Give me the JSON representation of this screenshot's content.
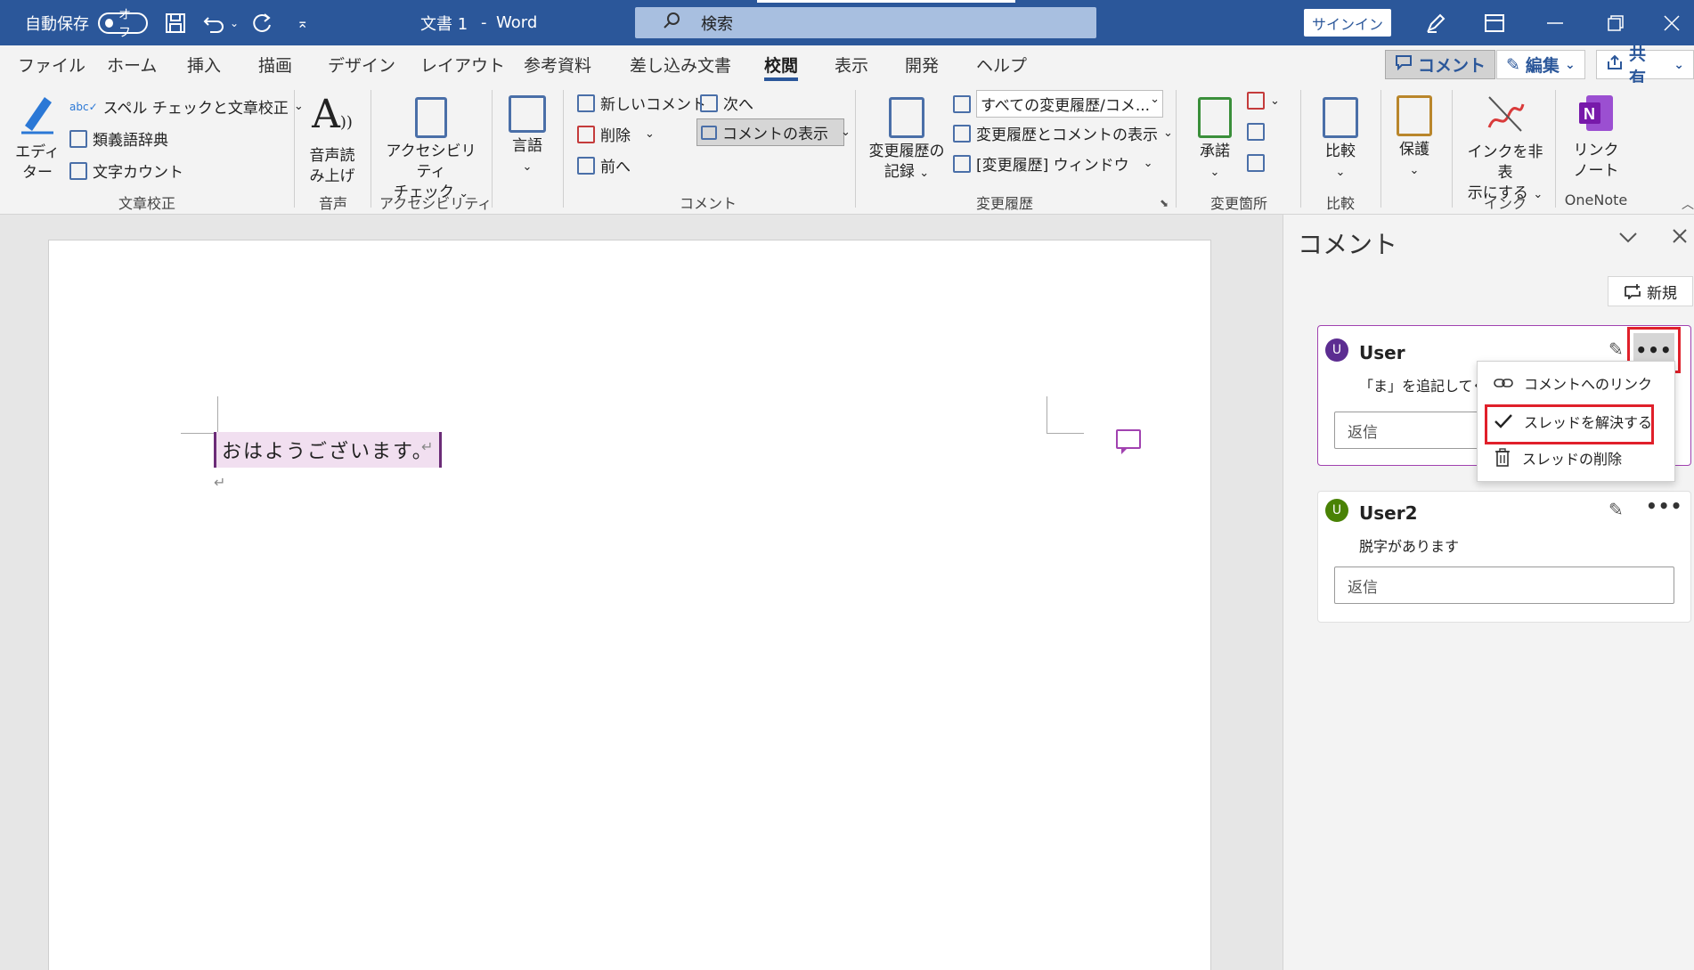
{
  "titlebar": {
    "autosave_label": "自動保存",
    "autosave_state": "オフ",
    "doc_title": "文書 1",
    "title_sep": "-",
    "app_name": "Word",
    "search_placeholder": "検索",
    "signin_label": "サインイン",
    "icons": [
      "save-icon",
      "undo-icon",
      "redo-icon",
      "customize-icon",
      "pen-icon",
      "ribbon-display-icon",
      "minimize-icon",
      "restore-icon",
      "close-icon"
    ]
  },
  "menu_tabs": [
    "ファイル",
    "ホーム",
    "挿入",
    "描画",
    "デザイン",
    "レイアウト",
    "参考資料",
    "差し込み文書",
    "校閲",
    "表示",
    "開発",
    "ヘルプ"
  ],
  "active_tab": "校閲",
  "menu_right": {
    "comment_label": "コメント",
    "edit_label": "編集",
    "share_label": "共有"
  },
  "ribbon": {
    "proofing": {
      "editor_label_1": "エディ",
      "editor_label_2": "ター",
      "spell_label": "スペル チェックと文章校正",
      "thesaurus_label": "類義語辞典",
      "wordcount_label": "文字カウント",
      "group_label": "文章校正"
    },
    "speech": {
      "readaloud_1": "音声読",
      "readaloud_2": "み上げ",
      "group_label": "音声"
    },
    "accessibility": {
      "check_1": "アクセシビリティ",
      "check_2": "チェック",
      "group_label": "アクセシビリティ"
    },
    "language": {
      "label": "言語"
    },
    "comments": {
      "new_label": "新しいコメント",
      "delete_label": "削除",
      "prev_label": "前へ",
      "next_label": "次へ",
      "show_label": "コメントの表示",
      "group_label": "コメント"
    },
    "tracking": {
      "track_1": "変更履歴の",
      "track_2": "記録",
      "markup_select": "すべての変更履歴/コメ...",
      "show_markup": "変更履歴とコメントの表示",
      "pane_label": "[変更履歴] ウィンドウ",
      "group_label": "変更履歴"
    },
    "changes": {
      "accept_label": "承諾",
      "group_label": "変更箇所"
    },
    "compare": {
      "label": "比較",
      "group_label": "比較"
    },
    "protect": {
      "label": "保護"
    },
    "ink": {
      "hide_1": "インクを非表",
      "hide_2": "示にする",
      "group_label": "インク"
    },
    "onenote": {
      "linked_1": "リンク",
      "linked_2": "ノート",
      "group_label": "OneNote"
    }
  },
  "document": {
    "text": "おはようございます。",
    "return_mark": "↵"
  },
  "comment_pane": {
    "title": "コメント",
    "new_label": "新規",
    "comments": [
      {
        "avatar": "U",
        "user": "User",
        "text": "「ま」を追記してくださ",
        "reply_placeholder": "返信",
        "avatar_color": "#5c2d91"
      },
      {
        "avatar": "U",
        "user": "User2",
        "text": "脱字があります",
        "reply_placeholder": "返信",
        "avatar_color": "#498205"
      }
    ],
    "context_menu": [
      {
        "label": "コメントへのリンク",
        "icon": "link-icon"
      },
      {
        "label": "スレッドを解決する",
        "icon": "checkmark-icon"
      },
      {
        "label": "スレッドの削除",
        "icon": "trash-icon"
      }
    ]
  },
  "colors": {
    "brand": "#2b579a",
    "highlight_red": "#e0202a",
    "comment_purple": "#a142b0"
  }
}
